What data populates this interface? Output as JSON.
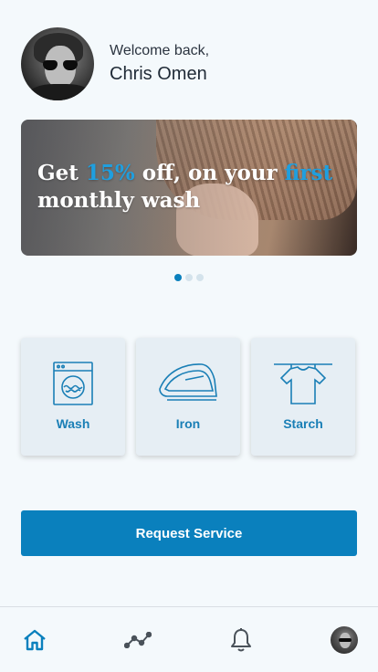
{
  "user": {
    "welcome": "Welcome back,",
    "name": "Chris Omen"
  },
  "banner": {
    "parts": [
      "Get ",
      "15%",
      " off, on your ",
      "first",
      " monthly wash"
    ],
    "highlight_color": "#1f9fdf"
  },
  "carousel": {
    "total": 3,
    "active_index": 0
  },
  "services": [
    {
      "label": "Wash",
      "icon": "washing-machine-icon"
    },
    {
      "label": "Iron",
      "icon": "iron-icon"
    },
    {
      "label": "Starch",
      "icon": "shirt-hanger-icon"
    }
  ],
  "cta": {
    "label": "Request Service"
  },
  "tabbar": {
    "items": [
      {
        "icon": "home-icon",
        "active": true
      },
      {
        "icon": "activity-icon",
        "active": false
      },
      {
        "icon": "bell-icon",
        "active": false
      },
      {
        "icon": "profile-avatar",
        "active": false
      }
    ],
    "active_color": "#0a80bd",
    "inactive_color": "#4a525a"
  },
  "colors": {
    "primary": "#0a80bd",
    "background": "#f4f9fc",
    "card": "#e6eef4"
  }
}
